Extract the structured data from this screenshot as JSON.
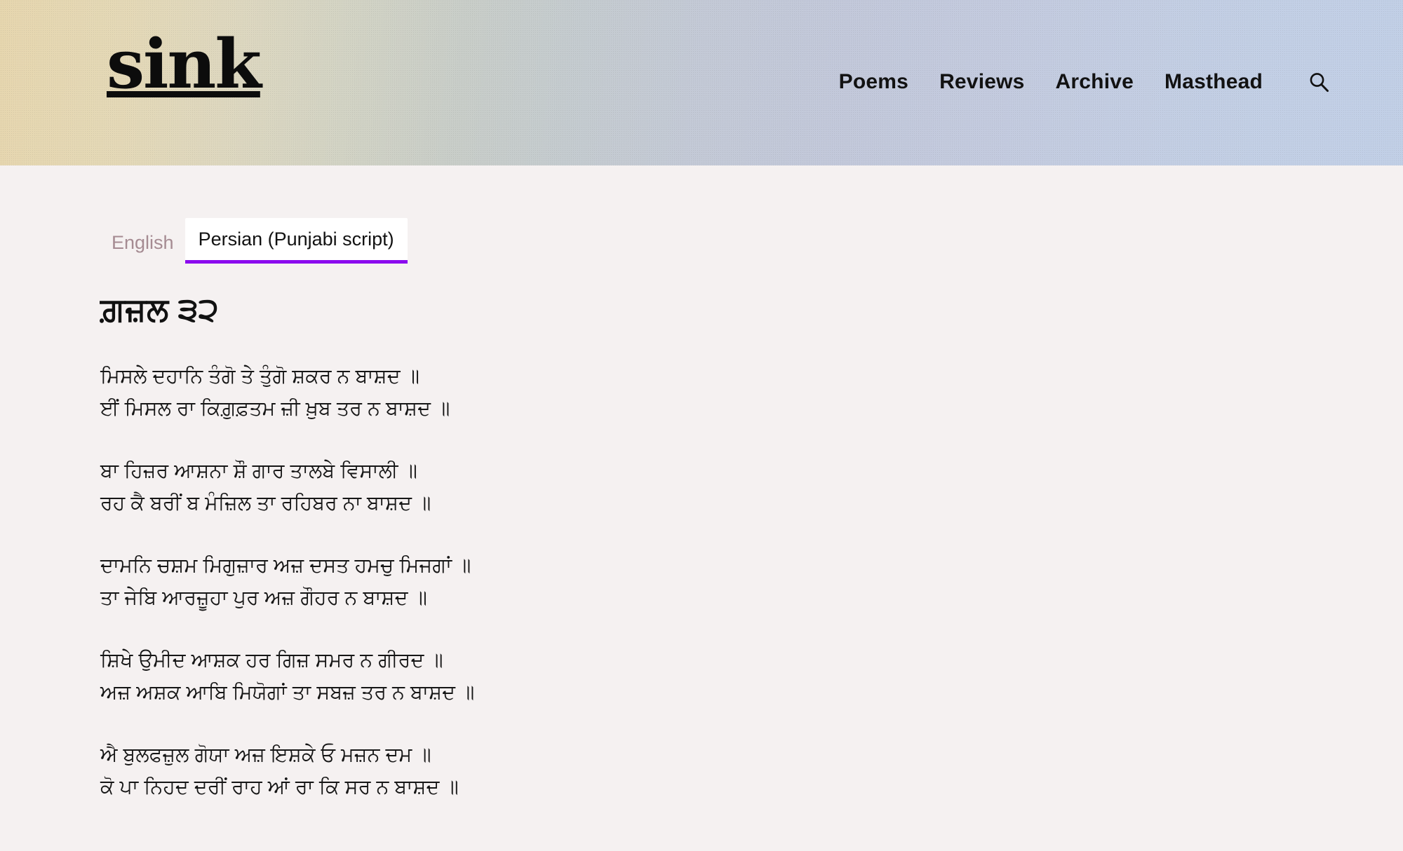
{
  "site": {
    "logo_text": "sink",
    "nav": [
      {
        "label": "Poems"
      },
      {
        "label": "Reviews"
      },
      {
        "label": "Archive"
      },
      {
        "label": "Masthead"
      }
    ],
    "search_icon": "search-icon",
    "header_gradient_from": "#e6d6ae",
    "header_gradient_to": "#c1cfe6",
    "page_background": "#f5f1f1"
  },
  "tabs": {
    "items": [
      {
        "label": "English",
        "active": false
      },
      {
        "label": "Persian (Punjabi script)",
        "active": true
      }
    ],
    "active_underline_color": "#8b0aee",
    "active_background": "#ffffff",
    "inactive_color": "#a58b92"
  },
  "poem": {
    "title": "ਗ਼ਜ਼ਲ ੩੨",
    "couplets": [
      [
        "ਮਿਸਲੇ ਦਹਾਨਿ ਤੰਗੋ ਤੇ ਤੁੰਗੋ ਸ਼ਕਰ ਨ ਬਾਸ਼ਦ ॥",
        "ਈਂ ਮਿਸਲ ਰਾ ਕਿਗ਼ੁਫ਼ਤਮ ਜ਼ੀ ਖ਼ੁਬ ਤਰ ਨ ਬਾਸ਼ਦ ॥"
      ],
      [
        "ਬਾ ਹਿਜ਼ਰ ਆਸ਼ਨਾ ਸ਼ੌ ਗਾਰ ਤਾਲਬੇ ਵਿਸਾਲੀ ॥",
        "ਰਹ ਕੈ ਬਰੀਂ ਬ ਮੰਜ਼ਿਲ ਤਾ ਰਹਿਬਰ ਨਾ ਬਾਸ਼ਦ ॥"
      ],
      [
        "ਦਾਮਨਿ ਚਸ਼ਮ ਮਿਗੁਜ਼ਾਰ ਅਜ਼ ਦਸਤ ਹਮਚੁ ਮਿਜਗਾਂ ॥",
        "ਤਾ ਜੇਬਿ ਆਰਜ਼ੂਹਾ ਪੁਰ ਅਜ਼ ਗੌਹਰ ਨ ਬਾਸ਼ਦ ॥"
      ],
      [
        "ਸ਼ਿਖੇ ਉਮੀਦ ਆਸ਼ਕ ਹਰ ਗਿਜ਼ ਸਮਰ ਨ ਗੀਰਦ ॥",
        "ਅਜ਼ ਅਸ਼ਕ ਆਬਿ ਮਿਯੋਗਾਂ ਤਾ ਸਬਜ਼ ਤਰ ਨ ਬਾਸ਼ਦ ॥"
      ],
      [
        "ਐ ਬੁਲਫਜ਼ੁਲ ਗੋਯਾ ਅਜ਼ ਇਸ਼ਕੇ ਓ ਮਜ਼ਨ ਦਮ ॥",
        "ਕੋ ਪਾ ਨਿਹਦ ਦਰੀਂ ਰਾਹ ਆਂ ਰਾ ਕਿ ਸਰ ਨ ਬਾਸ਼ਦ ॥"
      ]
    ]
  }
}
